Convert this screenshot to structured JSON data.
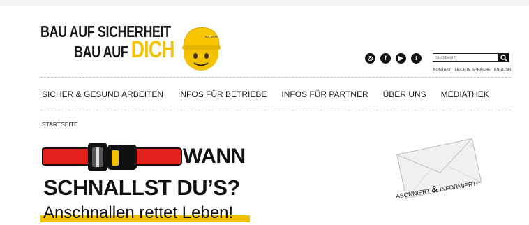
{
  "logo": {
    "line1": "BAU AUF SICHERHEIT",
    "line2_a": "BAU AUF ",
    "line2_b": "DICH",
    "mascot_badge": "BG BAU",
    "accent_color": "#f2c200"
  },
  "social": [
    {
      "name": "instagram-icon",
      "glyph": "◎"
    },
    {
      "name": "facebook-icon",
      "glyph": "f"
    },
    {
      "name": "youtube-icon",
      "glyph": "▶"
    },
    {
      "name": "twitter-icon",
      "glyph": "t"
    }
  ],
  "search": {
    "placeholder": "Suchbegriff",
    "icon": "search-icon"
  },
  "meta_links": [
    "KONTAKT",
    "LEICHTE SPRACHE",
    "ENGLISH"
  ],
  "nav": [
    "SICHER & GESUND ARBEITEN",
    "INFOS FÜR BETRIEBE",
    "INFOS FÜR PARTNER",
    "ÜBER UNS",
    "MEDIATHEK"
  ],
  "breadcrumb": "STARTSEITE",
  "hero": {
    "line1": "WANN",
    "line2": "SCHNALLST DU’S?",
    "line3": "Anschnallen rettet Leben!"
  },
  "newsletter": {
    "label_a": "ABONNIERT ",
    "label_amp": "&",
    "label_b": " INFORMIERT!"
  }
}
